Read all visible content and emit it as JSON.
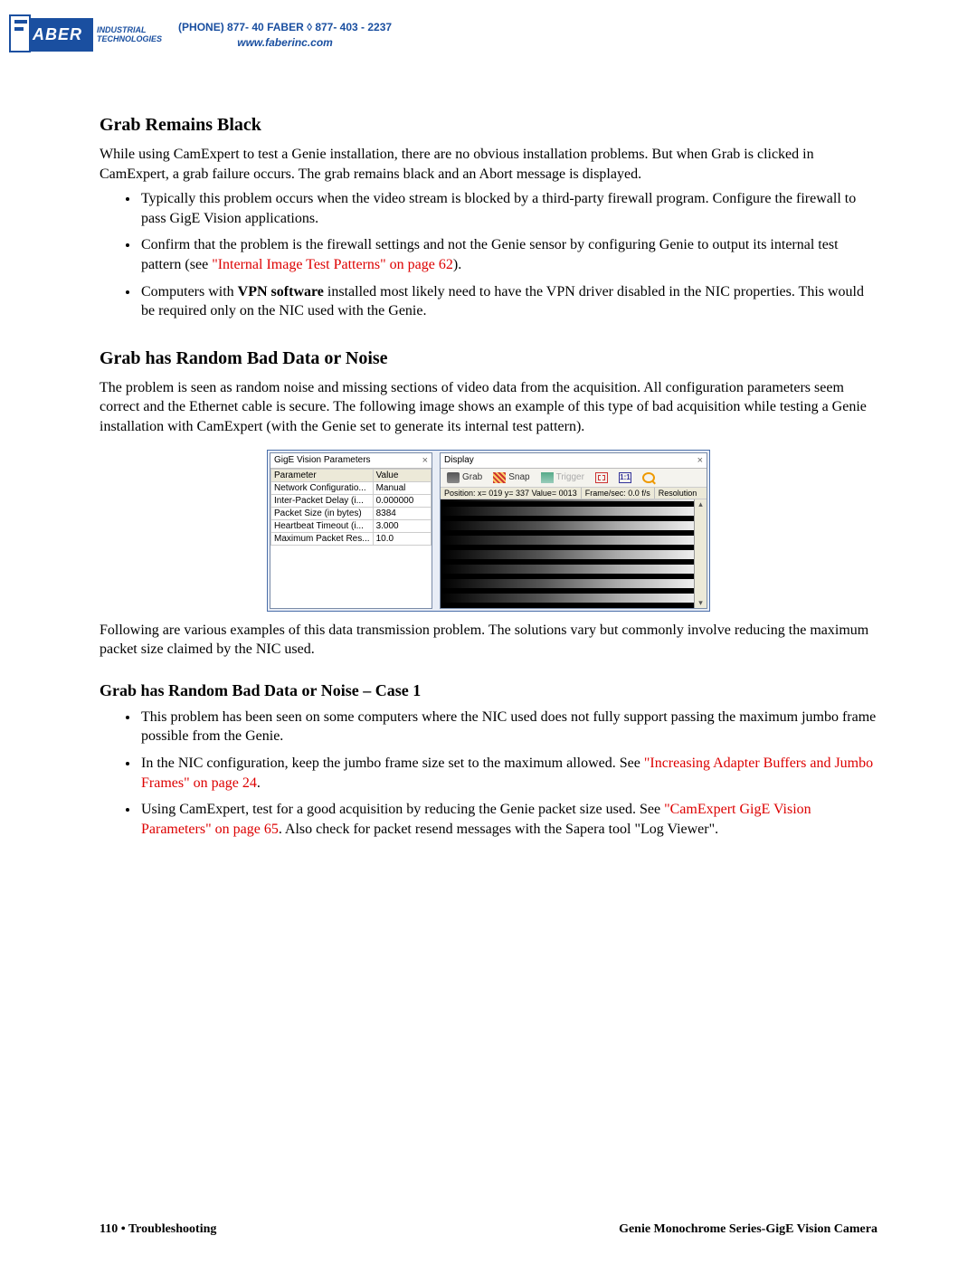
{
  "header": {
    "logo_text": "ABER",
    "tag1": "INDUSTRIAL",
    "tag2": "TECHNOLOGIES",
    "phone_line": "(PHONE) 877- 40 FABER  ◊  877- 403 - 2237",
    "url": "www.faberinc.com"
  },
  "section1": {
    "title": "Grab Remains Black",
    "intro": "While using CamExpert to test a Genie installation, there are no obvious installation problems. But when Grab is clicked in CamExpert, a grab failure occurs. The grab remains black and an Abort message is displayed.",
    "b1": "Typically this problem occurs when the video stream is blocked by a third-party firewall program. Configure the firewall to pass GigE Vision applications.",
    "b2a": "Confirm that the problem is the firewall settings and not the Genie sensor by configuring Genie to output its internal test pattern (see ",
    "b2link": "\"Internal Image Test Patterns\" on page 62",
    "b2b": ").",
    "b3a": "Computers with ",
    "b3bold": "VPN software",
    "b3b": " installed most likely need to have the VPN driver disabled in the NIC properties. This would be required only on the NIC used with the Genie."
  },
  "section2": {
    "title": "Grab has Random Bad Data or Noise",
    "intro": "The problem is seen as random noise and missing sections of video data from the acquisition. All configuration parameters seem correct and the Ethernet cable is secure. The following image shows an example of this type of bad acquisition while testing a Genie installation with CamExpert (with the Genie set to generate its internal test pattern).",
    "outro": "Following are various examples of this data transmission problem. The solutions vary but commonly involve reducing the maximum packet size claimed by the NIC used."
  },
  "app": {
    "left_title": "GigE Vision Parameters",
    "col_param": "Parameter",
    "col_value": "Value",
    "rows": [
      {
        "p": "Network Configuratio...",
        "v": "Manual"
      },
      {
        "p": "Inter-Packet Delay (i...",
        "v": "0.000000"
      },
      {
        "p": "Packet Size (in bytes)",
        "v": "8384"
      },
      {
        "p": "Heartbeat Timeout (i...",
        "v": "3.000"
      },
      {
        "p": "Maximum Packet Res...",
        "v": "10.0"
      }
    ],
    "right_title": "Display",
    "btn_grab": "Grab",
    "btn_snap": "Snap",
    "btn_trigger": "Trigger",
    "btn_11": "1:1",
    "status_pos": "Position:  x= 019 y= 337 Value= 0013",
    "status_fps": "Frame/sec: 0.0 f/s",
    "status_res": "Resolution"
  },
  "section3": {
    "title": "Grab has Random Bad Data or Noise – Case 1",
    "b1": "This problem has been seen on some computers where the NIC used does not fully support passing the maximum jumbo frame possible from the Genie.",
    "b2a": "In the NIC configuration, keep the jumbo frame size set to the maximum allowed. See ",
    "b2link": "\"Increasing Adapter Buffers and Jumbo Frames\" on page 24",
    "b2b": ".",
    "b3a": "Using CamExpert, test for a good acquisition by reducing the Genie packet size used. See ",
    "b3link": "\"CamExpert GigE Vision Parameters\" on page 65",
    "b3b": ". Also check for packet resend messages with the Sapera tool \"Log Viewer\"."
  },
  "footer": {
    "left": "110  •  Troubleshooting",
    "right": "Genie Monochrome Series-GigE Vision Camera"
  }
}
